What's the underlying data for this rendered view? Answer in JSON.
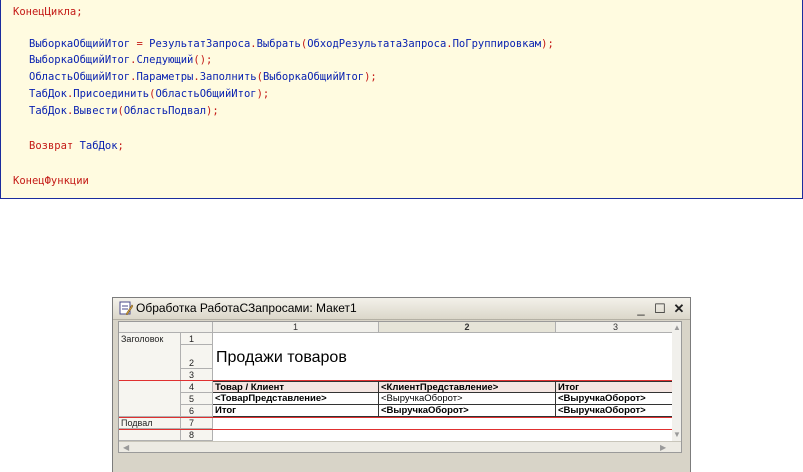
{
  "code": {
    "lines": [
      {
        "tokens": [
          {
            "t": "КонецЦикла;",
            "c": "kw"
          }
        ]
      },
      {
        "tokens": [
          {
            "t": "ВыборкаОбщийИтог",
            "c": "id"
          },
          {
            "t": " = ",
            "c": "pt"
          },
          {
            "t": "РезультатЗапроса",
            "c": "id"
          },
          {
            "t": ".",
            "c": "pt"
          },
          {
            "t": "Выбрать",
            "c": "id"
          },
          {
            "t": "(",
            "c": "pt"
          },
          {
            "t": "ОбходРезультатаЗапроса",
            "c": "id"
          },
          {
            "t": ".",
            "c": "pt"
          },
          {
            "t": "ПоГруппировкам",
            "c": "id"
          },
          {
            "t": ");",
            "c": "pt"
          }
        ]
      },
      {
        "tokens": [
          {
            "t": "ВыборкаОбщийИтог",
            "c": "id"
          },
          {
            "t": ".",
            "c": "pt"
          },
          {
            "t": "Следующий",
            "c": "id"
          },
          {
            "t": "();",
            "c": "pt"
          }
        ]
      },
      {
        "tokens": [
          {
            "t": "ОбластьОбщийИтог",
            "c": "id"
          },
          {
            "t": ".",
            "c": "pt"
          },
          {
            "t": "Параметры",
            "c": "id"
          },
          {
            "t": ".",
            "c": "pt"
          },
          {
            "t": "Заполнить",
            "c": "id"
          },
          {
            "t": "(",
            "c": "pt"
          },
          {
            "t": "ВыборкаОбщийИтог",
            "c": "id"
          },
          {
            "t": ");",
            "c": "pt"
          }
        ]
      },
      {
        "tokens": [
          {
            "t": "ТабДок",
            "c": "id"
          },
          {
            "t": ".",
            "c": "pt"
          },
          {
            "t": "Присоединить",
            "c": "id"
          },
          {
            "t": "(",
            "c": "pt"
          },
          {
            "t": "ОбластьОбщийИтог",
            "c": "id"
          },
          {
            "t": ");",
            "c": "pt"
          }
        ]
      },
      {
        "tokens": [
          {
            "t": "ТабДок",
            "c": "id"
          },
          {
            "t": ".",
            "c": "pt"
          },
          {
            "t": "Вывести",
            "c": "id"
          },
          {
            "t": "(",
            "c": "pt"
          },
          {
            "t": "ОбластьПодвал",
            "c": "id"
          },
          {
            "t": ");",
            "c": "pt"
          }
        ]
      },
      {
        "tokens": [
          {
            "t": "Возврат",
            "c": "kw"
          },
          {
            "t": " ",
            "c": "pt"
          },
          {
            "t": "ТабДок",
            "c": "id"
          },
          {
            "t": ";",
            "c": "pt"
          }
        ]
      },
      {
        "tokens": [
          {
            "t": "КонецФункции",
            "c": "kw"
          }
        ]
      }
    ]
  },
  "window": {
    "title": "Обработка РаботаСЗапросами: Макет1",
    "icon": "document-edit-icon",
    "buttons": {
      "minimize": "_",
      "maximize": "☐",
      "close": "✕"
    }
  },
  "sheet": {
    "columns": [
      "1",
      "2",
      "3"
    ],
    "active_column": "2",
    "groups": [
      "Заголовок",
      "Подвал"
    ],
    "row_numbers": [
      "1",
      "2",
      "3",
      "4",
      "5",
      "6",
      "7",
      "8"
    ],
    "title_text": "Продажи товаров",
    "header_row": [
      "Товар / Клиент",
      "<КлиентПредставление>",
      "Итог"
    ],
    "detail_row": [
      "<ТоварПредставление>",
      "<ВыручкаОборот>",
      "<ВыручкаОборот>"
    ],
    "total_row": [
      "Итог",
      "<ВыручкаОборот>",
      "<ВыручкаОборот>"
    ]
  },
  "colors": {
    "code_background": "#fffbe0",
    "keyword": "#c41a16",
    "identifier": "#0a22b0",
    "frame_border": "#1a2c9e",
    "area_separator": "#e03030"
  }
}
